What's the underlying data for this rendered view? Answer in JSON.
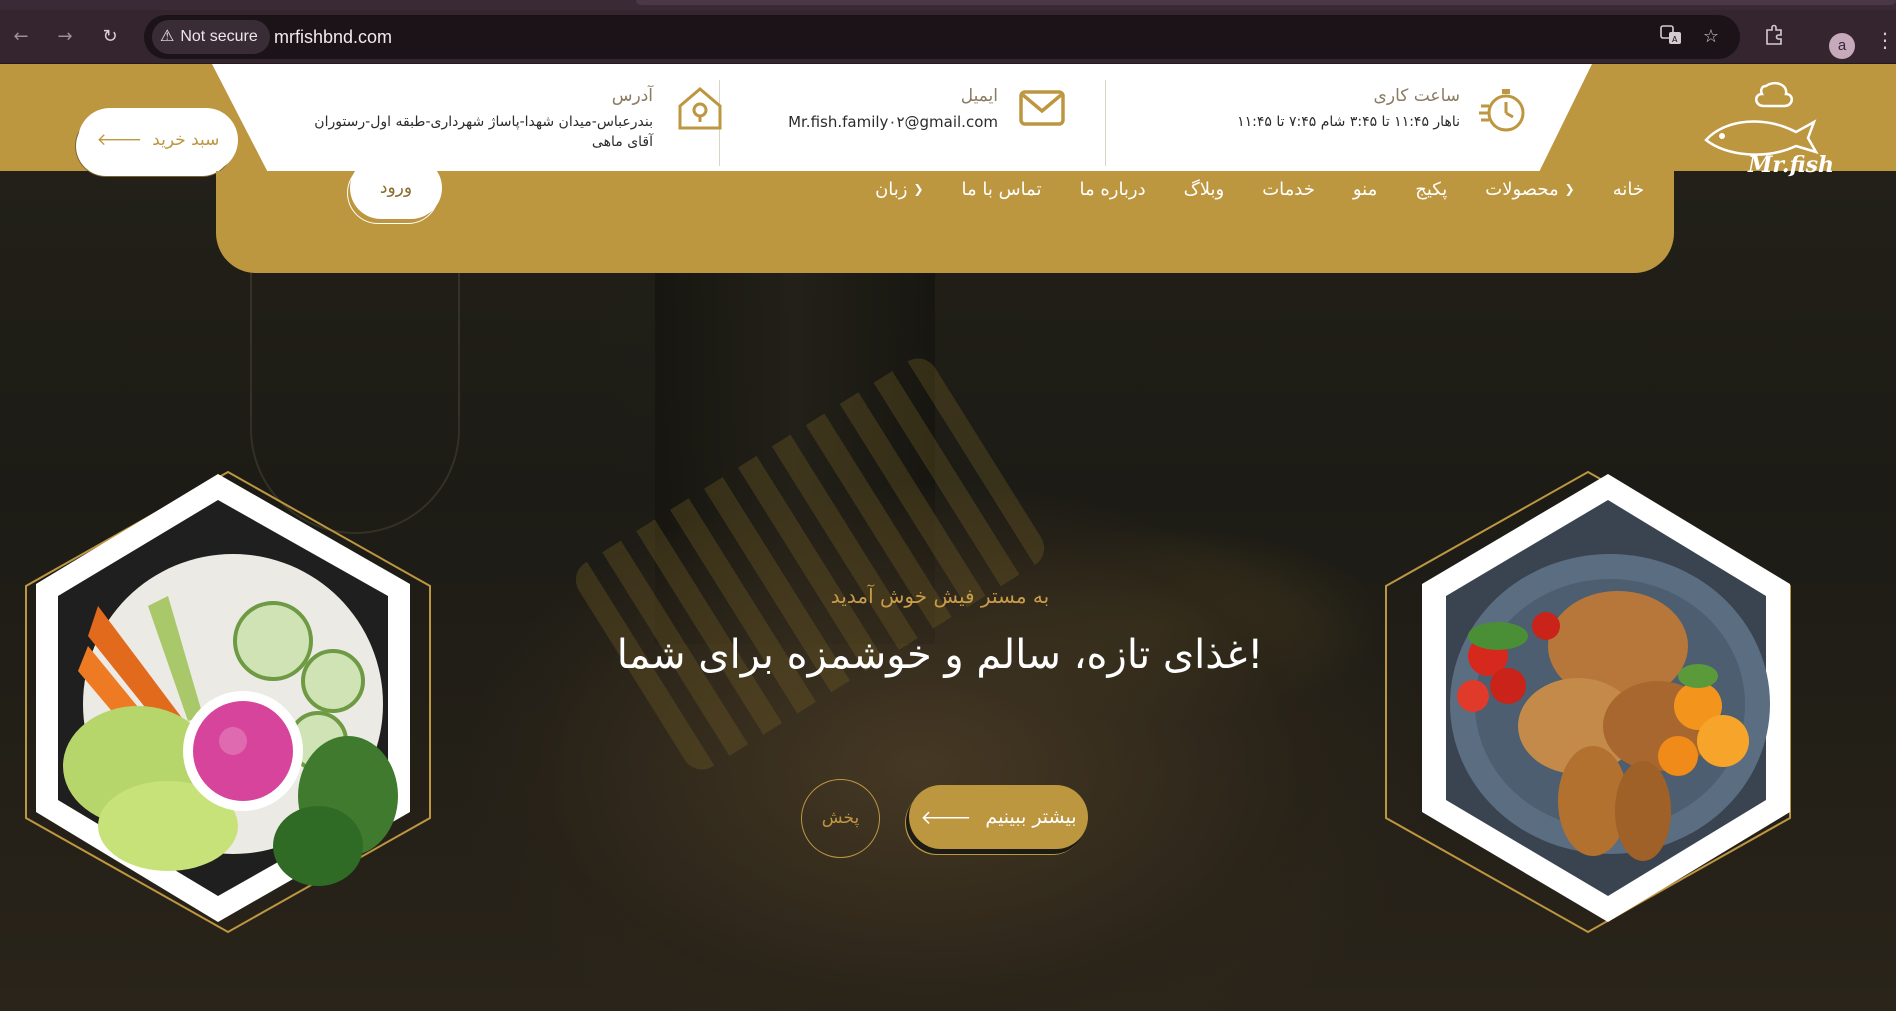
{
  "browser": {
    "nav_back_icon": "arrow-left-icon",
    "nav_forward_icon": "arrow-right-icon",
    "reload_icon": "reload-icon",
    "security_label": "Not secure",
    "url": "mrfishbnd.com",
    "profile_initial": "a"
  },
  "header": {
    "hours": {
      "title": "ساعت کاری",
      "text": "ناهار ۱۱:۴۵ تا ۳:۴۵ شام ۷:۴۵ تا ۱۱:۴۵"
    },
    "email": {
      "title": "ایمیل",
      "text": "Mr.fish.family۰۲@gmail.com"
    },
    "address": {
      "title": "آدرس",
      "text": "بندرعباس-میدان شهدا-پاساژ شهرداری-طبقه اول-رستوران آقای ماهی"
    },
    "cart_label": "سبد خرید",
    "logo_text": "Mr.fish",
    "accent_color": "#bd9640"
  },
  "nav": {
    "items": [
      {
        "label": "خانه",
        "dropdown": false
      },
      {
        "label": "محصولات",
        "dropdown": true
      },
      {
        "label": "پکیج",
        "dropdown": false
      },
      {
        "label": "منو",
        "dropdown": false
      },
      {
        "label": "خدمات",
        "dropdown": false
      },
      {
        "label": "وبلاگ",
        "dropdown": false
      },
      {
        "label": "درباره ما",
        "dropdown": false
      },
      {
        "label": "تماس با ما",
        "dropdown": false
      },
      {
        "label": "زبان",
        "dropdown": true
      }
    ],
    "login_label": "ورود"
  },
  "hero": {
    "welcome": "به مستر فیش خوش آمدید",
    "headline": "غذای تازه، سالم و خوشمزه برای شما!",
    "cta_label": "بیشتر ببینیم",
    "play_label": "پخش"
  }
}
